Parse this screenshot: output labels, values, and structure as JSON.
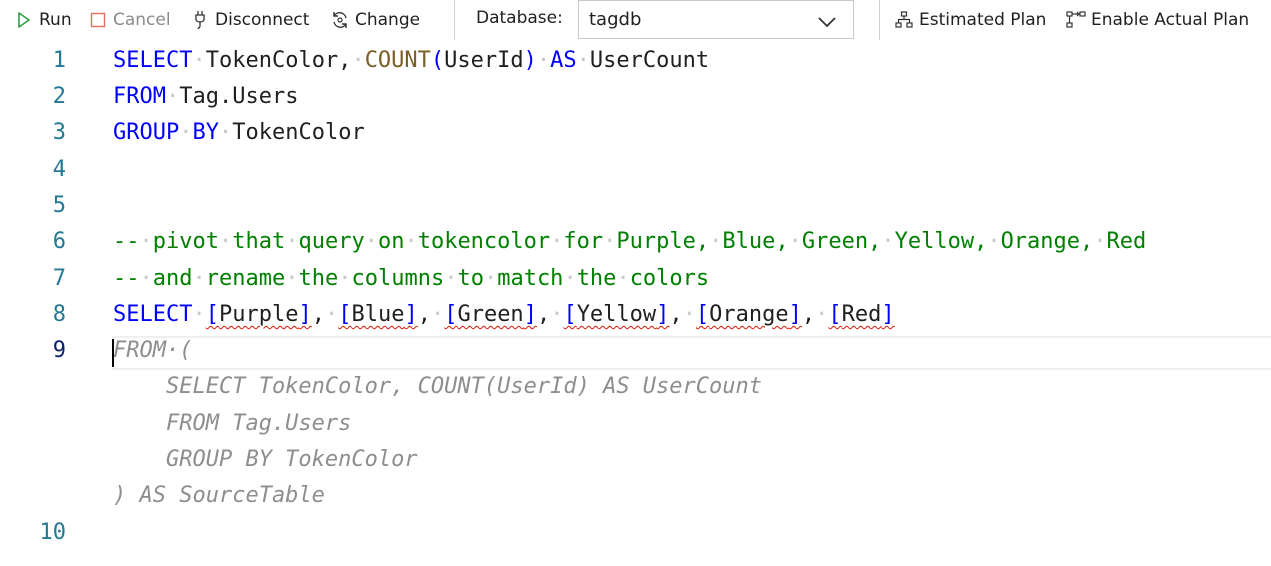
{
  "toolbar": {
    "run_label": "Run",
    "cancel_label": "Cancel",
    "disconnect_label": "Disconnect",
    "change_label": "Change",
    "database_label": "Database:",
    "database_value": "tagdb",
    "estimated_plan_label": "Estimated Plan",
    "actual_plan_label": "Enable Actual Plan"
  },
  "colors": {
    "keyword": "#0000ff",
    "function": "#795e26",
    "comment": "#008000",
    "line_number": "#237893",
    "ghost_text": "#8e8e8e",
    "error_squiggle": "#e51400",
    "run_icon": "#2e9e45",
    "cancel_icon": "#e0705a"
  },
  "editor": {
    "line_numbers": [
      "1",
      "2",
      "3",
      "4",
      "5",
      "6",
      "7",
      "8",
      "9",
      "10"
    ],
    "l1": {
      "kw1": "SELECT",
      "t1": "TokenColor,",
      "fn": "COUNT",
      "p1": "(",
      "t2": "UserId",
      "p2": ")",
      "kw2": "AS",
      "t3": "UserCount"
    },
    "l2": {
      "kw1": "FROM",
      "t1": "Tag.Users"
    },
    "l3": {
      "kw1": "GROUP",
      "kw2": "BY",
      "t1": "TokenColor"
    },
    "l6": {
      "c1": "--",
      "c2": "pivot",
      "c3": "that",
      "c4": "query",
      "c5": "on",
      "c6": "tokencolor",
      "c7": "for",
      "c8": "Purple,",
      "c9": "Blue,",
      "c10": "Green,",
      "c11": "Yellow,",
      "c12": "Orange,",
      "c13": "Red"
    },
    "l7": {
      "c1": "--",
      "c2": "and",
      "c3": "rename",
      "c4": "the",
      "c5": "columns",
      "c6": "to",
      "c7": "match",
      "c8": "the",
      "c9": "colors"
    },
    "l8": {
      "kw1": "SELECT",
      "ids": [
        "Purple",
        "Blue",
        "Green",
        "Yellow",
        "Orange",
        "Red"
      ]
    },
    "ghost": {
      "g1a": "FROM",
      "g1b": "(",
      "g2": "    SELECT TokenColor, COUNT(UserId) AS UserCount",
      "g3": "    FROM Tag.Users",
      "g4": "    GROUP BY TokenColor",
      "g5": ") AS SourceTable"
    }
  }
}
